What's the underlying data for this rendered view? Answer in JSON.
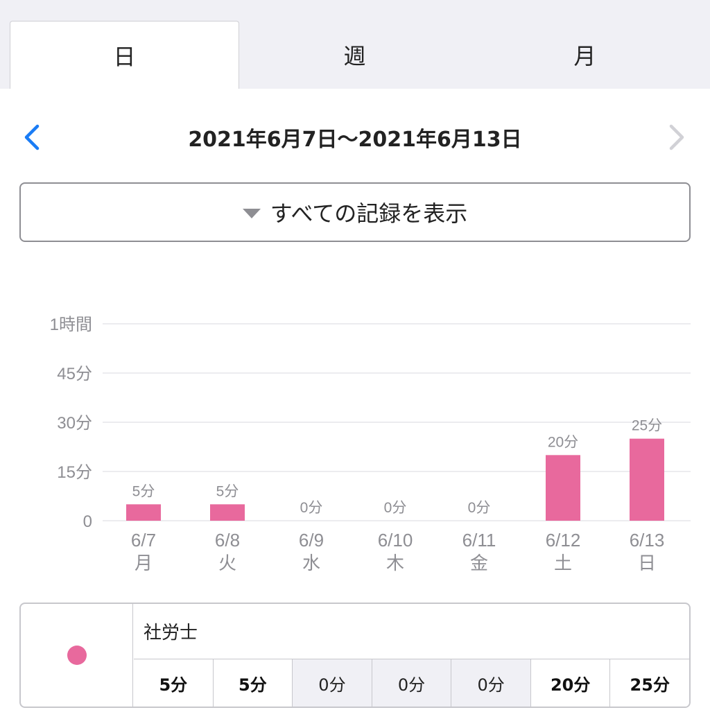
{
  "tabs": [
    {
      "label": "日",
      "active": true
    },
    {
      "label": "週",
      "active": false
    },
    {
      "label": "月",
      "active": false
    }
  ],
  "range": {
    "title": "2021年6月7日〜2021年6月13日",
    "prev_icon": "chevron-left-icon",
    "next_icon": "chevron-right-icon",
    "next_enabled": false
  },
  "filter": {
    "label": "すべての記録を表示",
    "icon": "triangle-down-icon"
  },
  "colors": {
    "accent": "#1a7cf5",
    "bar": "#e8699d",
    "grid": "#e5e5ea",
    "muted": "#8e8e93",
    "disabled": "#c7c7cc"
  },
  "chart_data": {
    "type": "bar",
    "ylim": [
      0,
      60
    ],
    "yticks": [
      {
        "value": 0,
        "label": "0"
      },
      {
        "value": 15,
        "label": "15分"
      },
      {
        "value": 30,
        "label": "30分"
      },
      {
        "value": 45,
        "label": "45分"
      },
      {
        "value": 60,
        "label": "1時間"
      }
    ],
    "grid": true,
    "categories": [
      {
        "date": "6/7",
        "weekday": "月"
      },
      {
        "date": "6/8",
        "weekday": "火"
      },
      {
        "date": "6/9",
        "weekday": "水"
      },
      {
        "date": "6/10",
        "weekday": "木"
      },
      {
        "date": "6/11",
        "weekday": "金"
      },
      {
        "date": "6/12",
        "weekday": "土"
      },
      {
        "date": "6/13",
        "weekday": "日"
      }
    ],
    "series": [
      {
        "name": "社労士",
        "values": [
          5,
          5,
          0,
          0,
          0,
          20,
          25
        ],
        "labels": [
          "5分",
          "5分",
          "0分",
          "0分",
          "0分",
          "20分",
          "25分"
        ]
      }
    ]
  },
  "legend": {
    "name": "社労士",
    "values": [
      "5分",
      "5分",
      "0分",
      "0分",
      "0分",
      "20分",
      "25分"
    ]
  }
}
